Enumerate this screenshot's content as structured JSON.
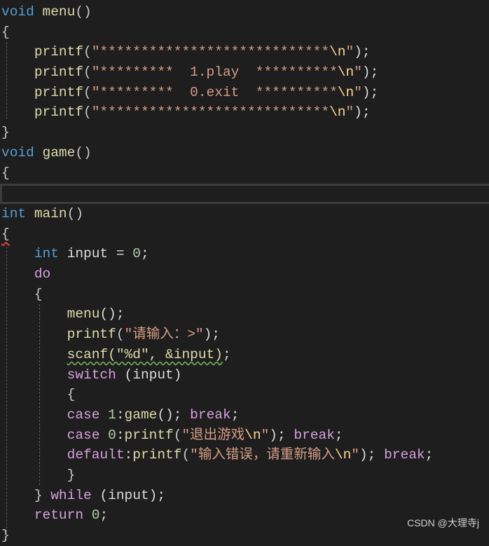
{
  "editor": {
    "top_lines": [
      [
        [
          "void",
          "kw"
        ],
        [
          " ",
          "pl"
        ],
        [
          "menu",
          "fn"
        ],
        [
          "()",
          "br"
        ]
      ],
      [
        [
          "{",
          "br"
        ]
      ],
      [
        [
          "    ",
          "pl"
        ],
        [
          "printf",
          "fn"
        ],
        [
          "(",
          "br"
        ],
        [
          "\"****************************",
          "str"
        ],
        [
          "\\n",
          "esc"
        ],
        [
          "\"",
          "str"
        ],
        [
          ");",
          "pl"
        ]
      ],
      [
        [
          "    ",
          "pl"
        ],
        [
          "printf",
          "fn"
        ],
        [
          "(",
          "br"
        ],
        [
          "\"*********  1.play  **********",
          "str"
        ],
        [
          "\\n",
          "esc"
        ],
        [
          "\"",
          "str"
        ],
        [
          ");",
          "pl"
        ]
      ],
      [
        [
          "    ",
          "pl"
        ],
        [
          "printf",
          "fn"
        ],
        [
          "(",
          "br"
        ],
        [
          "\"*********  0.exit  **********",
          "str"
        ],
        [
          "\\n",
          "esc"
        ],
        [
          "\"",
          "str"
        ],
        [
          ");",
          "pl"
        ]
      ],
      [
        [
          "    ",
          "pl"
        ],
        [
          "printf",
          "fn"
        ],
        [
          "(",
          "br"
        ],
        [
          "\"****************************",
          "str"
        ],
        [
          "\\n",
          "esc"
        ],
        [
          "\"",
          "str"
        ],
        [
          ");",
          "pl"
        ]
      ],
      [
        [
          "}",
          "br"
        ]
      ],
      [
        [
          "void",
          "kw"
        ],
        [
          " ",
          "pl"
        ],
        [
          "game",
          "fn"
        ],
        [
          "()",
          "br"
        ]
      ],
      [
        [
          "{",
          "br"
        ]
      ]
    ],
    "bottom_lines": [
      [
        [
          "int",
          "kw"
        ],
        [
          " ",
          "pl"
        ],
        [
          "main",
          "fn"
        ],
        [
          "()",
          "br"
        ]
      ],
      [
        [
          "{",
          "br err"
        ]
      ],
      [
        [
          "    ",
          "pl"
        ],
        [
          "int",
          "kw"
        ],
        [
          " input = ",
          "pl"
        ],
        [
          "0",
          "num"
        ],
        [
          ";",
          "pl"
        ]
      ],
      [
        [
          "    ",
          "pl"
        ],
        [
          "do",
          "ctl"
        ]
      ],
      [
        [
          "    ",
          "pl"
        ],
        [
          "{",
          "br"
        ]
      ],
      [
        [
          "        ",
          "pl"
        ],
        [
          "menu",
          "fn"
        ],
        [
          "();",
          "pl"
        ]
      ],
      [
        [
          "        ",
          "pl"
        ],
        [
          "printf",
          "fn"
        ],
        [
          "(",
          "br"
        ],
        [
          "\"请输入：>\"",
          "str"
        ],
        [
          ");",
          "pl"
        ]
      ],
      [
        [
          "        ",
          "pl"
        ],
        [
          "scanf(\"%d\", &input)",
          "fn warn"
        ],
        [
          ";",
          "pl"
        ]
      ],
      [
        [
          "        ",
          "pl"
        ],
        [
          "switch",
          "ctl"
        ],
        [
          " (input)",
          "pl"
        ]
      ],
      [
        [
          "        ",
          "pl"
        ],
        [
          "{",
          "br"
        ]
      ],
      [
        [
          "        ",
          "pl"
        ],
        [
          "case",
          "ctl"
        ],
        [
          " ",
          "pl"
        ],
        [
          "1",
          "num"
        ],
        [
          ":",
          "pl"
        ],
        [
          "game",
          "fn"
        ],
        [
          "(); ",
          "pl"
        ],
        [
          "break",
          "ctl"
        ],
        [
          ";",
          "pl"
        ]
      ],
      [
        [
          "        ",
          "pl"
        ],
        [
          "case",
          "ctl"
        ],
        [
          " ",
          "pl"
        ],
        [
          "0",
          "num"
        ],
        [
          ":",
          "pl"
        ],
        [
          "printf",
          "fn"
        ],
        [
          "(",
          "br"
        ],
        [
          "\"退出游戏",
          "str"
        ],
        [
          "\\n",
          "esc"
        ],
        [
          "\"",
          "str"
        ],
        [
          "); ",
          "pl"
        ],
        [
          "break",
          "ctl"
        ],
        [
          ";",
          "pl"
        ]
      ],
      [
        [
          "        ",
          "pl"
        ],
        [
          "default",
          "ctl"
        ],
        [
          ":",
          "pl"
        ],
        [
          "printf",
          "fn"
        ],
        [
          "(",
          "br"
        ],
        [
          "\"输入错误，请重新输入",
          "str"
        ],
        [
          "\\n",
          "esc"
        ],
        [
          "\"",
          "str"
        ],
        [
          "); ",
          "pl"
        ],
        [
          "break",
          "ctl"
        ],
        [
          ";",
          "pl"
        ]
      ],
      [
        [
          "        ",
          "pl"
        ],
        [
          "}",
          "br"
        ]
      ],
      [
        [
          "    ",
          "pl"
        ],
        [
          "}",
          "br"
        ],
        [
          " ",
          "pl"
        ],
        [
          "while",
          "ctl"
        ],
        [
          " (input);",
          "pl"
        ]
      ],
      [
        [
          "    ",
          "pl"
        ],
        [
          "return",
          "ctl"
        ],
        [
          " ",
          "pl"
        ],
        [
          "0",
          "num"
        ],
        [
          ";",
          "pl"
        ]
      ],
      [
        [
          "}",
          "br"
        ]
      ]
    ]
  },
  "watermark": "CSDN @大理寺j"
}
